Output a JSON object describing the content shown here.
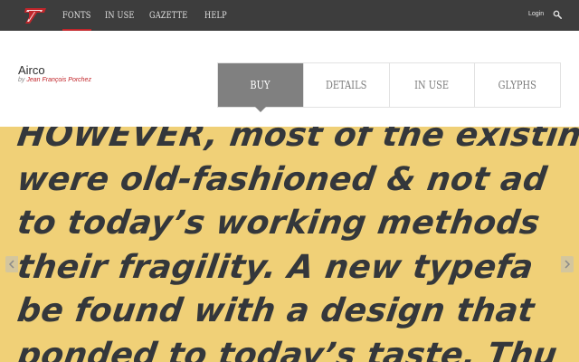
{
  "nav": {
    "items": [
      {
        "label": "FONTS",
        "active": true
      },
      {
        "label": "IN USE",
        "active": false
      },
      {
        "label": "GAZETTE",
        "active": false
      },
      {
        "label": "HELP",
        "active": false
      }
    ],
    "login_label": "Login",
    "accent_color": "#c2262b"
  },
  "font": {
    "name": "Airco",
    "by_label": "by",
    "designer": "Jean François Porchez"
  },
  "tabs": [
    {
      "label": "BUY",
      "active": true
    },
    {
      "label": "DETAILS",
      "active": false
    },
    {
      "label": "IN USE",
      "active": false
    },
    {
      "label": "GLYPHS",
      "active": false
    }
  ],
  "specimen": {
    "background": "#f0d077",
    "text_color": "#34373b",
    "lines": [
      "HOWEVER, most of the existing",
      "were old-fashioned & not ad",
      "to today’s working methods",
      "their fragility. A new typefa",
      "be found with a design that",
      "ponded to today’s taste. Thu"
    ]
  },
  "icons": {
    "logo": "logo-icon",
    "search": "search-icon",
    "prev": "chevron-left-icon",
    "next": "chevron-right-icon"
  }
}
